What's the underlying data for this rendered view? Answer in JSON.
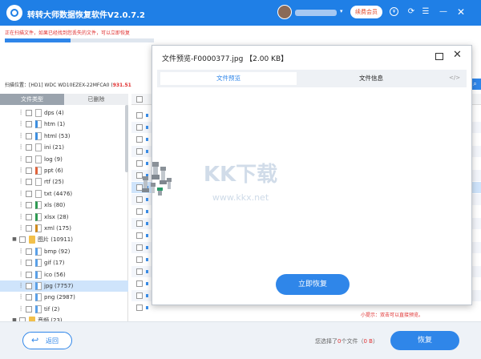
{
  "app": {
    "title": "转转大师数据恢复软件V2.0.7.2",
    "member_label": "续费会员",
    "dropdown_glyph": "▾"
  },
  "status": {
    "scanning_text": "正在扫描文件，如果已经找到您丢失的文件，可以立即恢复",
    "progress_fraction": 0.44
  },
  "scan_location": {
    "label": "扫描位置：",
    "path": "[HD1] WDC WD10EZEX-22MFCA0 (",
    "size": "931.51"
  },
  "file_tabs": [
    "文件类型",
    "已删除"
  ],
  "tree": [
    {
      "label": "dps (4)",
      "level": 2,
      "icon": "doc"
    },
    {
      "label": "htm (1)",
      "level": 2,
      "icon": "htm"
    },
    {
      "label": "html (53)",
      "level": 2,
      "icon": "htm"
    },
    {
      "label": "ini (21)",
      "level": 2,
      "icon": "doc"
    },
    {
      "label": "log (9)",
      "level": 2,
      "icon": "doc"
    },
    {
      "label": "ppt (6)",
      "level": 2,
      "icon": "ppt"
    },
    {
      "label": "rtf (25)",
      "level": 2,
      "icon": "doc"
    },
    {
      "label": "txt (4476)",
      "level": 2,
      "icon": "doc"
    },
    {
      "label": "xls (80)",
      "level": 2,
      "icon": "xls"
    },
    {
      "label": "xlsx (28)",
      "level": 2,
      "icon": "xls"
    },
    {
      "label": "xml (175)",
      "level": 2,
      "icon": "xml"
    },
    {
      "label": "图片 (10911)",
      "level": 1,
      "icon": "folder",
      "expanded": true
    },
    {
      "label": "bmp (92)",
      "level": 2,
      "icon": "img"
    },
    {
      "label": "gif (17)",
      "level": 2,
      "icon": "img"
    },
    {
      "label": "ico (56)",
      "level": 2,
      "icon": "img"
    },
    {
      "label": "jpg (7757)",
      "level": 2,
      "icon": "img",
      "selected": true
    },
    {
      "label": "png (2987)",
      "level": 2,
      "icon": "img"
    },
    {
      "label": "tif (2)",
      "level": 2,
      "icon": "img"
    },
    {
      "label": "音频 (23)",
      "level": 1,
      "icon": "folder",
      "expanded": true
    }
  ],
  "list": {
    "tip": "小提示：双击可以直接预览。"
  },
  "bottom": {
    "back_label": "返回",
    "selected_prefix": "您选择了",
    "selected_count": "0",
    "selected_mid": "个文件（",
    "selected_size": "0 B",
    "selected_suffix": "）",
    "recover_label": "恢复"
  },
  "dialog": {
    "title": "文件预览-F0000377.jpg 【2.00 KB】",
    "tabs": [
      "文件预览",
      "文件信息"
    ],
    "code_icon_text": "</>",
    "recover_now_label": "立即恢复",
    "watermark": {
      "logo_text": "KK下载",
      "url_text": "www.kkx.net"
    }
  },
  "colors": {
    "brand_blue": "#1f7fe6",
    "button_blue": "#2f86e9",
    "alert_red": "#e03030"
  },
  "icons": {
    "minimize": "minimize-icon",
    "close": "close-icon",
    "maximize": "maximize-icon",
    "back": "back-arrow-icon",
    "search": "search-icon"
  }
}
